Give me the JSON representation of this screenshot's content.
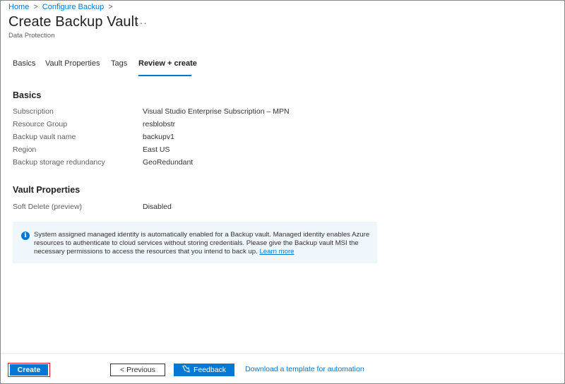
{
  "breadcrumb": {
    "items": [
      "Home",
      "Configure Backup"
    ],
    "separator": ">"
  },
  "header": {
    "title": "Create Backup Vault",
    "more": "···",
    "subtitle": "Data Protection"
  },
  "tabs": [
    {
      "label": "Basics"
    },
    {
      "label": "Vault Properties"
    },
    {
      "label": "Tags"
    },
    {
      "label": "Review + create",
      "selected": true
    }
  ],
  "basics": {
    "title": "Basics",
    "rows": [
      {
        "label": "Subscription",
        "value": "Visual Studio Enterprise Subscription – MPN"
      },
      {
        "label": "Resource Group",
        "value": "resblobstr"
      },
      {
        "label": "Backup vault name",
        "value": "backupv1"
      },
      {
        "label": "Region",
        "value": "East US"
      },
      {
        "label": "Backup storage redundancy",
        "value": "GeoRedundant"
      }
    ]
  },
  "vault_properties": {
    "title": "Vault Properties",
    "rows": [
      {
        "label": "Soft Delete (preview)",
        "value": "Disabled"
      }
    ]
  },
  "info": {
    "icon": "info-icon",
    "text": "System assigned managed identity is automatically enabled for a Backup vault. Managed identity enables Azure resources to authenticate to cloud services without storing credentials. Please give the Backup vault MSI the necessary permissions to access the resources that you intend to back up.",
    "link": "Learn more"
  },
  "footer": {
    "create": "Create",
    "previous": "< Previous",
    "feedback": "Feedback",
    "template_link": "Download a template for automation"
  },
  "colors": {
    "accent": "#0078d4",
    "highlight_border": "#e81123",
    "info_bg": "#eff6fc"
  }
}
